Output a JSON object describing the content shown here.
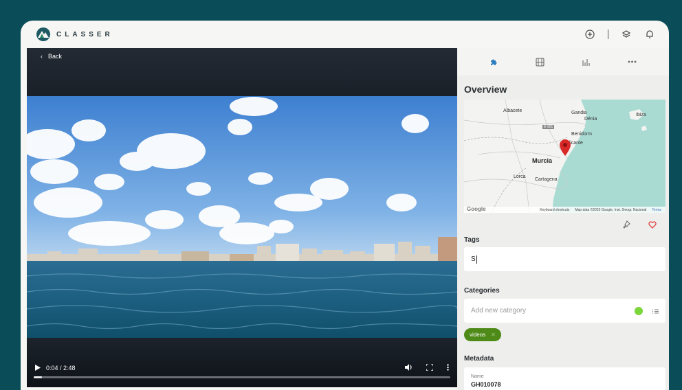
{
  "app": {
    "name": "CLASSER"
  },
  "header": {
    "actions": [
      {
        "icon": "plus-circle-icon"
      },
      {
        "icon": "layers-icon"
      },
      {
        "icon": "bell-icon"
      }
    ]
  },
  "player": {
    "back_label": "Back",
    "time": "0:04 / 2:48",
    "progress": 0.02
  },
  "panel": {
    "tabs": [
      {
        "icon": "puzzle-icon",
        "active": true
      },
      {
        "icon": "film-icon",
        "active": false
      },
      {
        "icon": "bar-chart-icon",
        "active": false
      },
      {
        "icon": "more-icon",
        "active": false
      }
    ],
    "overview_title": "Overview",
    "map": {
      "labels": {
        "albacete": "Albacete",
        "gandia": "Gandia",
        "denia": "Dénia",
        "ibiza": "Ibiza",
        "benidorm": "Benidorm",
        "alicante": "Alicante",
        "murcia": "Murcia",
        "lorca": "Lorca",
        "cartagena": "Cartagena",
        "road": "E-901"
      },
      "google": "Google",
      "shortcuts": "Keyboard shortcuts",
      "attribution": "Map data ©2023 Google, Inst. Geogr. Nacional",
      "terms": "Terms"
    },
    "tags_title": "Tags",
    "tags_value": "S",
    "categories_title": "Categories",
    "categories_placeholder": "Add new category",
    "category_chip": "videos",
    "metadata_title": "Metadata",
    "metadata_name_label": "Name",
    "metadata_name_value": "GH010078"
  },
  "colors": {
    "background": "#0a4d59",
    "accent_green": "#7bd63b",
    "chip_green": "#4e8a18",
    "heart_red": "#e03a3a",
    "pin_red": "#d82828"
  }
}
